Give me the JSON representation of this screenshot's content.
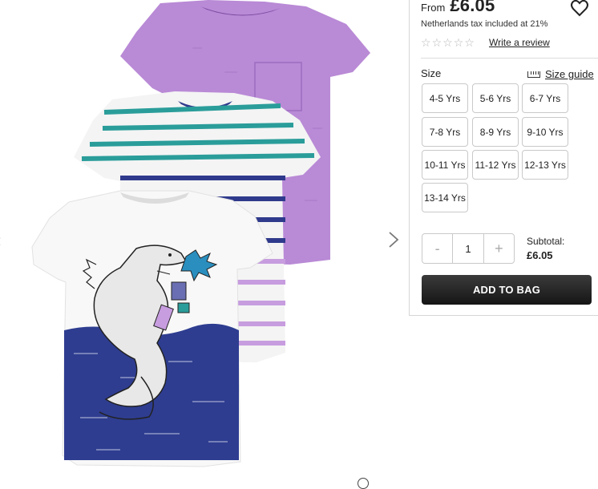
{
  "product": {
    "from_label": "From",
    "price": "£6.05",
    "tax_note": "Netherlands tax included at 21%",
    "rating_stars": 0,
    "rating_max": 5,
    "review_link": "Write a review"
  },
  "size_section": {
    "label": "Size",
    "guide_link": "Size guide",
    "options": [
      "4-5 Yrs",
      "5-6 Yrs",
      "6-7 Yrs",
      "7-8 Yrs",
      "8-9 Yrs",
      "9-10 Yrs",
      "10-11 Yrs",
      "11-12 Yrs",
      "12-13 Yrs",
      "13-14 Yrs"
    ]
  },
  "quantity": {
    "minus": "-",
    "value": "1",
    "plus": "+"
  },
  "subtotal": {
    "label": "Subtotal:",
    "value": "£6.05"
  },
  "cart": {
    "add_label": "ADD TO BAG"
  },
  "icons": {
    "wishlist": "heart-icon",
    "prev": "chevron-left-icon",
    "next": "chevron-right-icon",
    "size_guide": "ruler-icon",
    "zoom": "zoom-icon"
  },
  "colors": {
    "shirt_purple": "#b98ad6",
    "stripe_teal": "#2a9d9a",
    "stripe_navy": "#2f3a8c",
    "stripe_lilac": "#c79ddf",
    "print_blue": "#2e3d90",
    "button_dark": "#222222"
  }
}
